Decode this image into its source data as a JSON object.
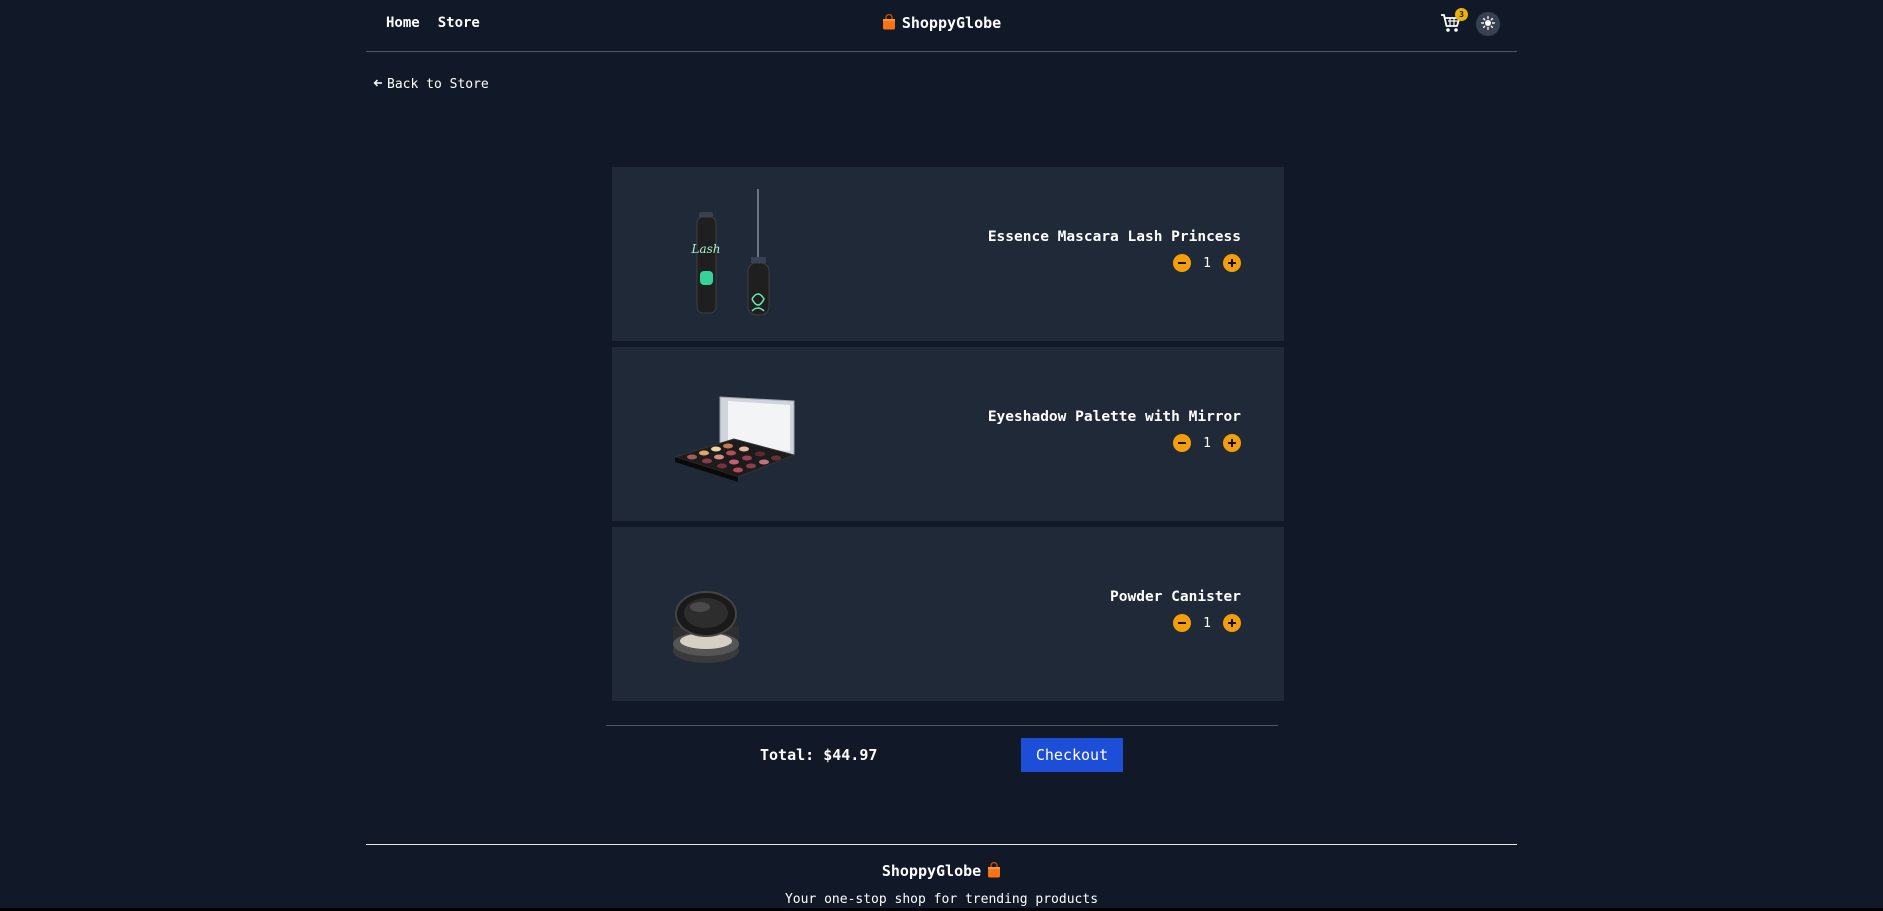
{
  "nav": {
    "links": [
      {
        "label": "Home"
      },
      {
        "label": "Store"
      }
    ],
    "brand": "ShoppyGlobe"
  },
  "header": {
    "cart_count": "3",
    "theme_icon": "sun-icon",
    "cart_icon": "cart-icon"
  },
  "back_link": {
    "label": "Back to Store"
  },
  "cart": {
    "items": [
      {
        "title": "Essence Mascara Lash Princess",
        "quantity": "1",
        "image": "mascara-image"
      },
      {
        "title": "Eyeshadow Palette with Mirror",
        "quantity": "1",
        "image": "eyeshadow-palette-image"
      },
      {
        "title": "Powder Canister",
        "quantity": "1",
        "image": "powder-canister-image"
      }
    ],
    "total_label": "Total: $44.97",
    "checkout_label": "Checkout"
  },
  "footer": {
    "brand": "ShoppyGlobe",
    "tagline": "Your one-stop shop for trending products"
  },
  "colors": {
    "background": "#111827",
    "card": "#1f2937",
    "accent": "#f59e0b",
    "checkout": "#1d4ed8",
    "badge": "#eab308"
  }
}
